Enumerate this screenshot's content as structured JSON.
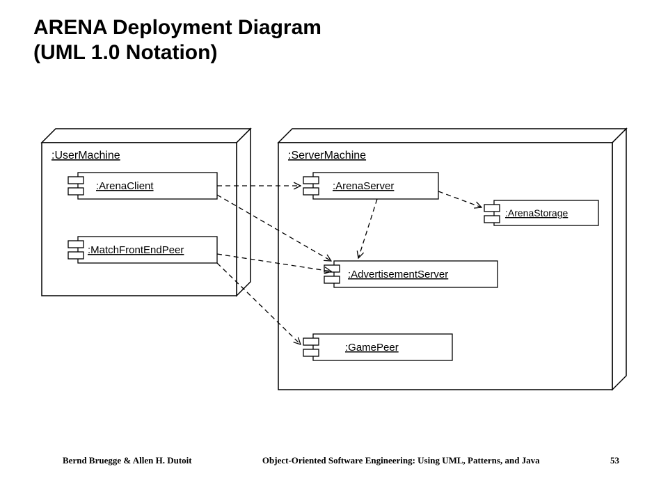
{
  "title_line1": "ARENA Deployment Diagram",
  "title_line2": "(UML 1.0 Notation)",
  "nodes": {
    "user_machine": ":UserMachine",
    "server_machine": ":ServerMachine"
  },
  "components": {
    "arena_client": ":ArenaClient",
    "match_front_end_peer": ":MatchFrontEndPeer",
    "arena_server": ":ArenaServer",
    "advertisement_server": ":AdvertisementServer",
    "game_peer": ":GamePeer",
    "arena_storage": ":ArenaStorage"
  },
  "dependencies": [
    {
      "from": "arena_client",
      "to": "arena_server"
    },
    {
      "from": "arena_client",
      "to": "advertisement_server"
    },
    {
      "from": "match_front_end_peer",
      "to": "advertisement_server"
    },
    {
      "from": "match_front_end_peer",
      "to": "game_peer"
    },
    {
      "from": "arena_server",
      "to": "arena_storage"
    },
    {
      "from": "arena_server",
      "to": "advertisement_server"
    }
  ],
  "footer": {
    "left": "Bernd Bruegge & Allen H. Dutoit",
    "center": "Object-Oriented Software Engineering: Using UML, Patterns, and Java",
    "right": "53"
  }
}
